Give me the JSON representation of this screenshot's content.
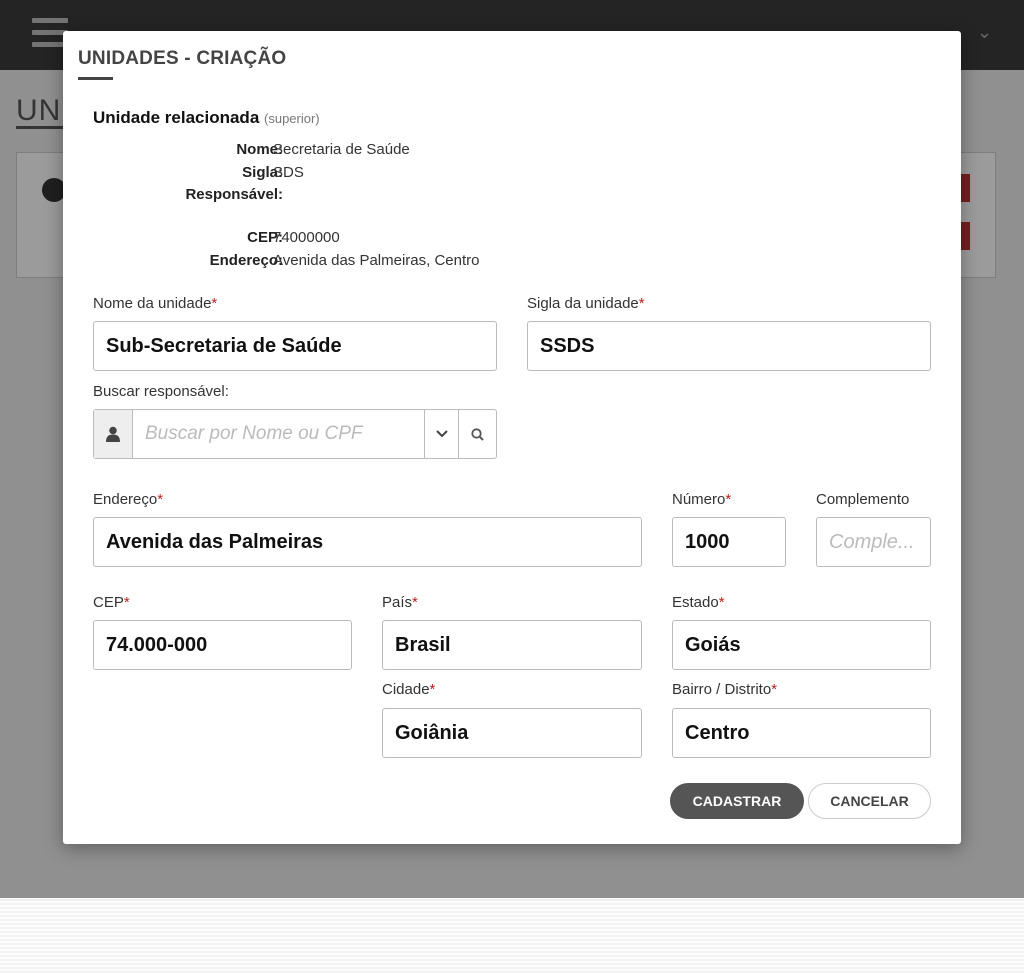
{
  "modal": {
    "title": "UNIDADES - CRIAÇÃO",
    "related": {
      "heading": "Unidade relacionada",
      "heading_note": "(superior)",
      "fields": [
        {
          "label": "Nome:",
          "value": "Secretaria de Saúde"
        },
        {
          "label": "Sigla:",
          "value": "SDS"
        },
        {
          "label": "Responsável:",
          "value": ""
        },
        {
          "label": "CEP:",
          "value": "74000000"
        },
        {
          "label": "Endereço:",
          "value": "Avenida das Palmeiras, Centro"
        }
      ]
    },
    "form": {
      "nome_label": "Nome da unidade",
      "nome_value": "Sub-Secretaria de Saúde",
      "sigla_label": "Sigla da unidade",
      "sigla_value": "SSDS",
      "responsavel_label": "Buscar responsável:",
      "responsavel_placeholder": "Buscar por Nome ou CPF",
      "endereco_label": "Endereço",
      "endereco_value": "Avenida das Palmeiras",
      "numero_label": "Número",
      "numero_value": "1000",
      "complemento_label": "Complemento",
      "complemento_placeholder": "Comple...",
      "cep_label": "CEP",
      "cep_value": "74.000-000",
      "pais_label": "País",
      "pais_value": "Brasil",
      "estado_label": "Estado",
      "estado_value": "Goiás",
      "cidade_label": "Cidade",
      "cidade_value": "Goiânia",
      "bairro_label": "Bairro / Distrito",
      "bairro_value": "Centro",
      "required_mark": "*"
    },
    "buttons": {
      "submit": "CADASTRAR",
      "cancel": "CANCELAR"
    }
  },
  "background": {
    "page_title": "UN"
  },
  "icons": {
    "menu": "hamburger-icon",
    "user": "user-icon",
    "chevron": "chevron-down-icon",
    "search": "search-icon"
  },
  "colors": {
    "primary_button": "#555555",
    "required": "#bb2222",
    "header": "#3a3a3a"
  }
}
